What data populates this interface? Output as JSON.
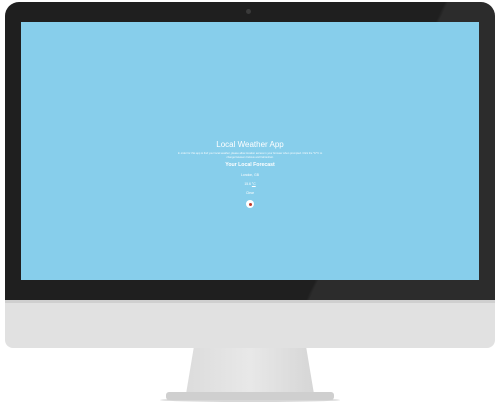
{
  "app": {
    "title": "Local Weather App",
    "description": "In order for this app to find your local weather, please allow location access in your browser when prompted. Click the °F/°C to change between Celsius and Fahrenheit.",
    "forecast_heading": "Your Local Forecast",
    "location": "London, GB",
    "temperature": "15.6",
    "unit": "°C",
    "condition": "Clear",
    "icon": "clear-weather-icon"
  },
  "colors": {
    "screen_background": "#87ceeb",
    "bezel": "#1f1f1f",
    "chin": "#e1e1e1",
    "text": "#ffffff"
  }
}
